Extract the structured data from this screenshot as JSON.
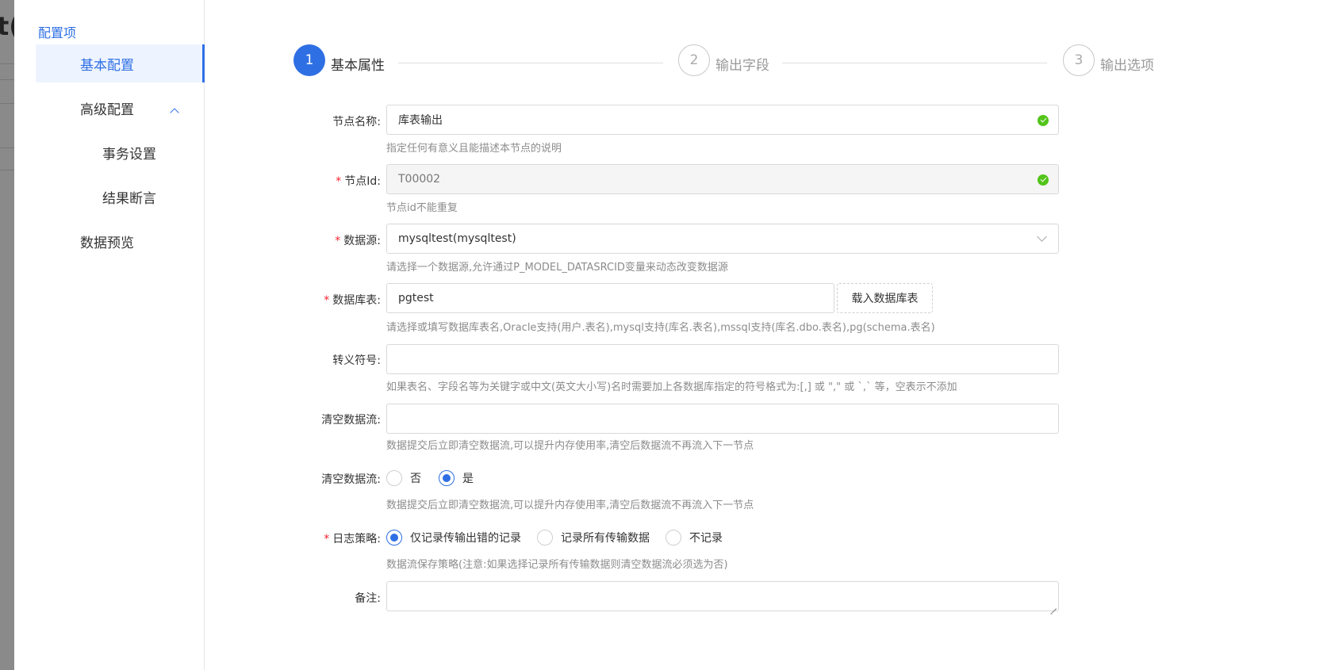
{
  "backdrop": {
    "text": "t("
  },
  "sidebar": {
    "title": "配置项",
    "items": [
      {
        "label": "基本配置",
        "active": true
      },
      {
        "label": "高级配置",
        "expanded": true
      },
      {
        "label": "事务设置"
      },
      {
        "label": "结果断言"
      },
      {
        "label": "数据预览"
      }
    ]
  },
  "steps": [
    {
      "number": "1",
      "label": "基本属性",
      "status": "active"
    },
    {
      "number": "2",
      "label": "输出字段",
      "status": "inactive"
    },
    {
      "number": "3",
      "label": "输出选项",
      "status": "inactive"
    }
  ],
  "form": {
    "node_name": {
      "label": "节点名称:",
      "value": "库表输出",
      "help": "指定任何有意义且能描述本节点的说明"
    },
    "node_id": {
      "label": "节点Id:",
      "required": true,
      "value": "T00002",
      "help": "节点id不能重复"
    },
    "datasource": {
      "label": "数据源:",
      "required": true,
      "value": "mysqltest(mysqltest)",
      "help": "请选择一个数据源,允许通过P_MODEL_DATASRCID变量来动态改变数据源"
    },
    "db_table": {
      "label": "数据库表:",
      "required": true,
      "value": "pgtest",
      "button": "载入数据库表",
      "help": "请选择或填写数据库表名,Oracle支持(用户.表名),mysql支持(库名.表名),mssql支持(库名.dbo.表名),pg(schema.表名)"
    },
    "escape_symbol": {
      "label": "转义符号:",
      "value": "",
      "help": "如果表名、字段名等为关键字或中文(英文大小写)名时需要加上各数据库指定的符号格式为:[,] 或 \",\" 或 `,` 等，空表示不添加"
    },
    "clear_stream_input": {
      "label": "清空数据流:",
      "value": "",
      "help": "数据提交后立即清空数据流,可以提升内存使用率,清空后数据流不再流入下一节点"
    },
    "clear_stream_radio": {
      "label": "清空数据流:",
      "options": [
        "否",
        "是"
      ],
      "selected": "是",
      "help": "数据提交后立即清空数据流,可以提升内存使用率,清空后数据流不再流入下一节点"
    },
    "log_policy": {
      "label": "日志策略:",
      "required": true,
      "options": [
        "仅记录传输出错的记录",
        "记录所有传输数据",
        "不记录"
      ],
      "selected": "仅记录传输出错的记录",
      "help": "数据流保存策略(注意:如果选择记录所有传输数据则清空数据流必须选为否)"
    },
    "remark": {
      "label": "备注:",
      "value": ""
    }
  },
  "colors": {
    "accent": "#2f6fe4",
    "success": "#52c41a",
    "required": "#f5222d"
  }
}
